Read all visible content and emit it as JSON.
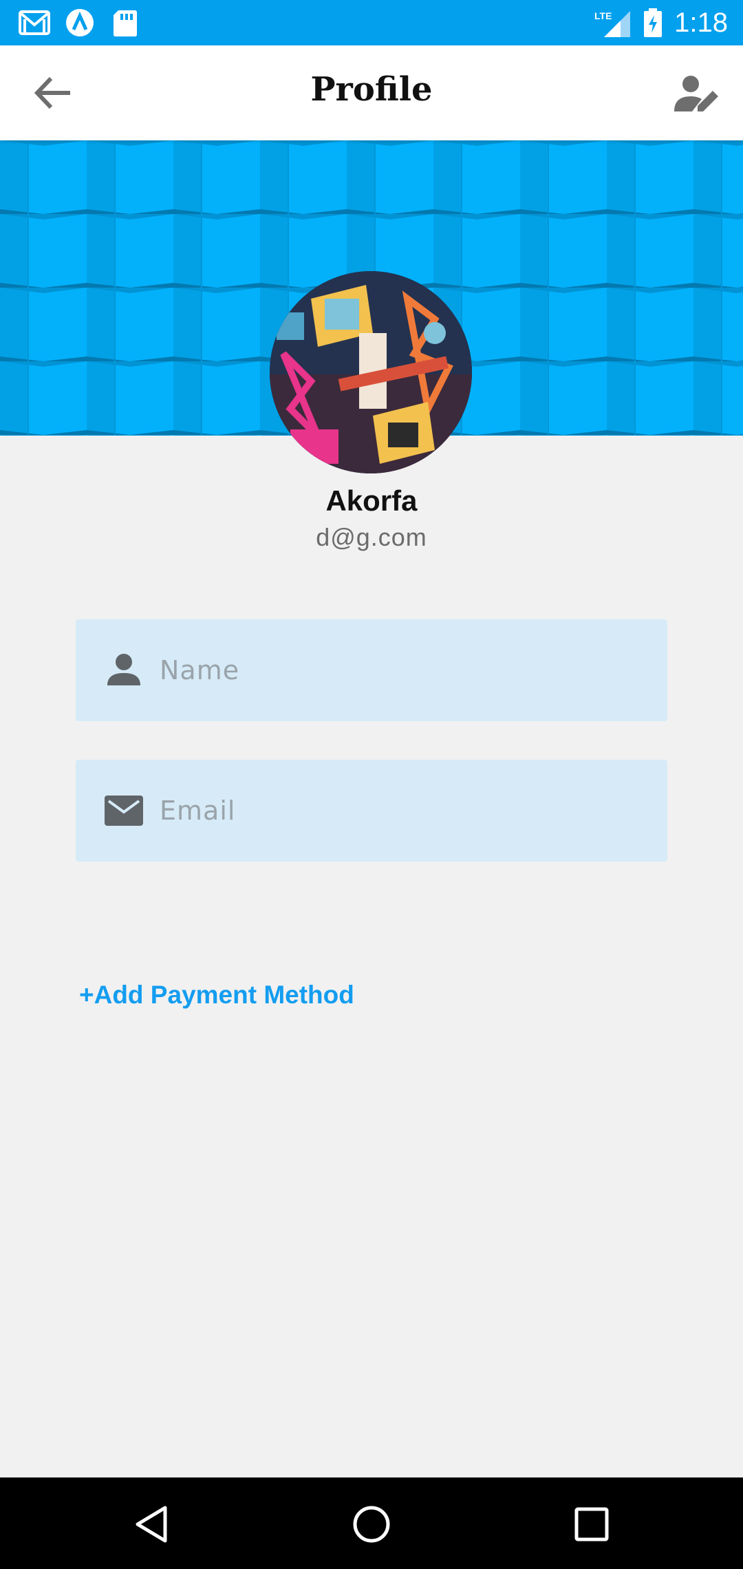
{
  "status_bar": {
    "time": "1:18",
    "network": "LTE",
    "left_icons": [
      "gmail-icon",
      "app-a-icon",
      "sd-card-icon"
    ],
    "right_icons": [
      "lte-signal-icon",
      "battery-charging-icon"
    ]
  },
  "app_bar": {
    "title": "Profile",
    "left_icon": "arrow-back-icon",
    "right_icon": "edit-profile-icon"
  },
  "profile": {
    "name": "Akorfa",
    "email": "d@g.com"
  },
  "form": {
    "name_placeholder": "Name",
    "name_value": "",
    "email_placeholder": "Email",
    "email_value": ""
  },
  "actions": {
    "add_payment_label": "+Add Payment Method"
  },
  "nav_bar": {
    "buttons": [
      "back-triangle-icon",
      "home-circle-icon",
      "recents-square-icon"
    ]
  },
  "colors": {
    "status_bar": "#03a0ee",
    "banner": "#03b3ff",
    "accent_link": "#139df0",
    "field_bg": "#d6ebf7"
  }
}
